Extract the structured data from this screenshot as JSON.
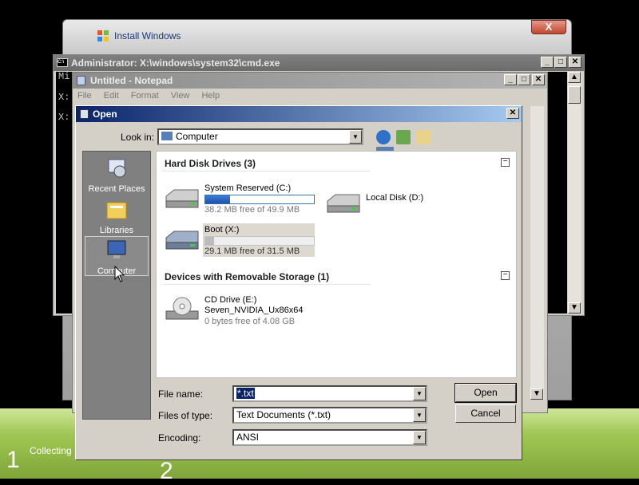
{
  "setup": {
    "step1_number": "1",
    "step1_text": "Collecting",
    "step2_number": "2"
  },
  "install_window": {
    "title": "Install Windows",
    "close_glyph": "X"
  },
  "cmd_window": {
    "title": "Administrator: X:\\windows\\system32\\cmd.exe",
    "lines": [
      "Mi",
      "",
      "X:",
      "X:"
    ]
  },
  "notepad": {
    "title": "Untitled - Notepad",
    "menu": [
      "File",
      "Edit",
      "Format",
      "View",
      "Help"
    ]
  },
  "open_dialog": {
    "title": "Open",
    "look_in_label": "Look in:",
    "look_in_value": "Computer",
    "places": [
      "Recent Places",
      "Libraries",
      "Computer"
    ],
    "groups": {
      "hdd_header": "Hard Disk Drives (3)",
      "removable_header": "Devices with Removable Storage (1)"
    },
    "drives": [
      {
        "name": "System Reserved (C:)",
        "free": "38.2 MB free of 49.9 MB",
        "used_fraction": 0.23
      },
      {
        "name": "Local Disk (D:)"
      },
      {
        "name": "Boot (X:)",
        "free": "29.1 MB free of 31.5 MB",
        "used_fraction": 0.08
      },
      {
        "name": "CD Drive (E:)",
        "label": "Seven_NVIDIA_Ux86x64",
        "free": "0 bytes free of 4.08 GB"
      }
    ],
    "file_name_label": "File name:",
    "file_name_value": "*.txt",
    "files_of_type_label": "Files of type:",
    "files_of_type_value": "Text Documents (*.txt)",
    "encoding_label": "Encoding:",
    "encoding_value": "ANSI",
    "open_button": "Open",
    "cancel_button": "Cancel",
    "collapse_glyph": "−"
  }
}
